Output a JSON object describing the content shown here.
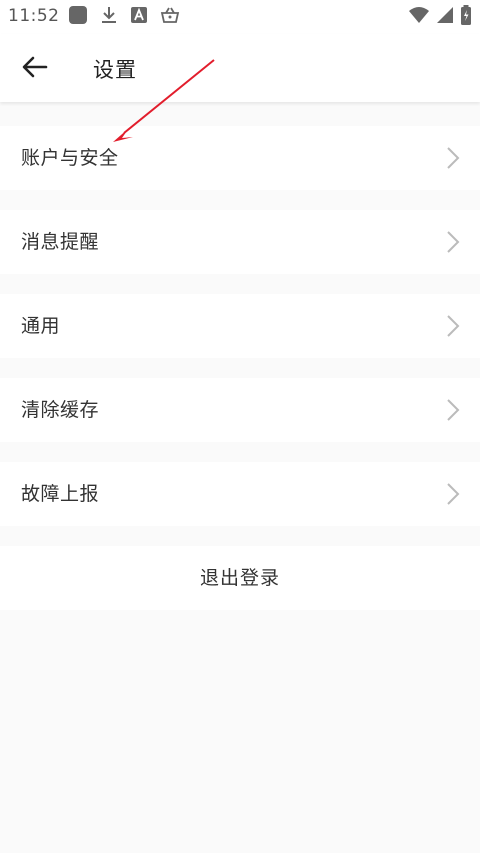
{
  "status_bar": {
    "time": "11:52",
    "left_icons": [
      "app-square-icon",
      "download-icon",
      "font-a-icon",
      "shopping-basket-icon"
    ],
    "right_icons": [
      "wifi-icon",
      "signal-icon",
      "battery-charging-icon"
    ]
  },
  "header": {
    "title": "设置",
    "back_icon": "back-arrow-icon"
  },
  "menu": {
    "items": [
      {
        "label": "账户与安全",
        "icon": "chevron-right-icon"
      },
      {
        "label": "消息提醒",
        "icon": "chevron-right-icon"
      },
      {
        "label": "通用",
        "icon": "chevron-right-icon"
      },
      {
        "label": "清除缓存",
        "icon": "chevron-right-icon"
      },
      {
        "label": "故障上报",
        "icon": "chevron-right-icon"
      }
    ]
  },
  "logout": {
    "label": "退出登录"
  },
  "colors": {
    "background": "#fafafa",
    "card": "#ffffff",
    "text": "#333333",
    "chevron": "#bbbbbb",
    "annotation_arrow": "#e21d2c"
  }
}
